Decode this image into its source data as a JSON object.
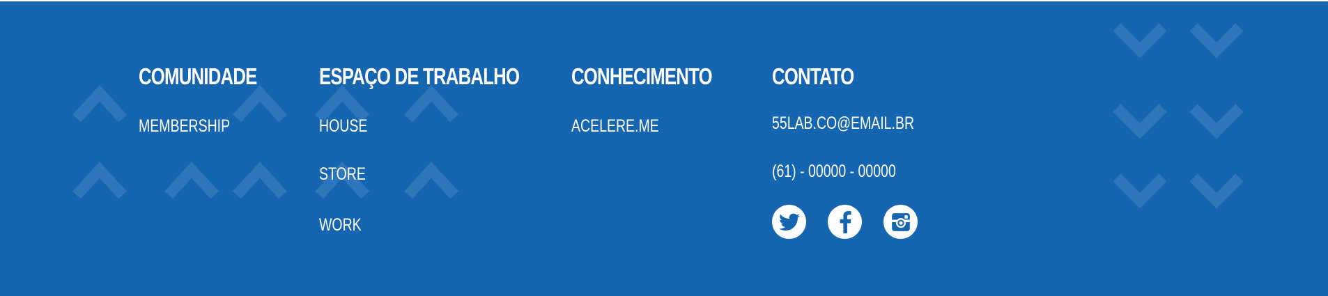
{
  "footer": {
    "colors": {
      "background": "#1565b0",
      "text": "#ffffff",
      "pattern": "#2e76bb"
    },
    "community": {
      "heading": "COMUNIDADE",
      "links": [
        "MEMBERSHIP"
      ]
    },
    "workspace": {
      "heading": "ESPAÇO DE TRABALHO",
      "links": [
        "HOUSE",
        "STORE",
        "WORK"
      ]
    },
    "knowledge": {
      "heading": "CONHECIMENTO",
      "links": [
        "ACELERE.ME"
      ]
    },
    "contact": {
      "heading": "CONTATO",
      "email": "55LAB.CO@EMAIL.BR",
      "phone": "(61) - 00000 - 00000",
      "social": [
        "twitter-icon",
        "facebook-icon",
        "instagram-icon"
      ]
    }
  }
}
